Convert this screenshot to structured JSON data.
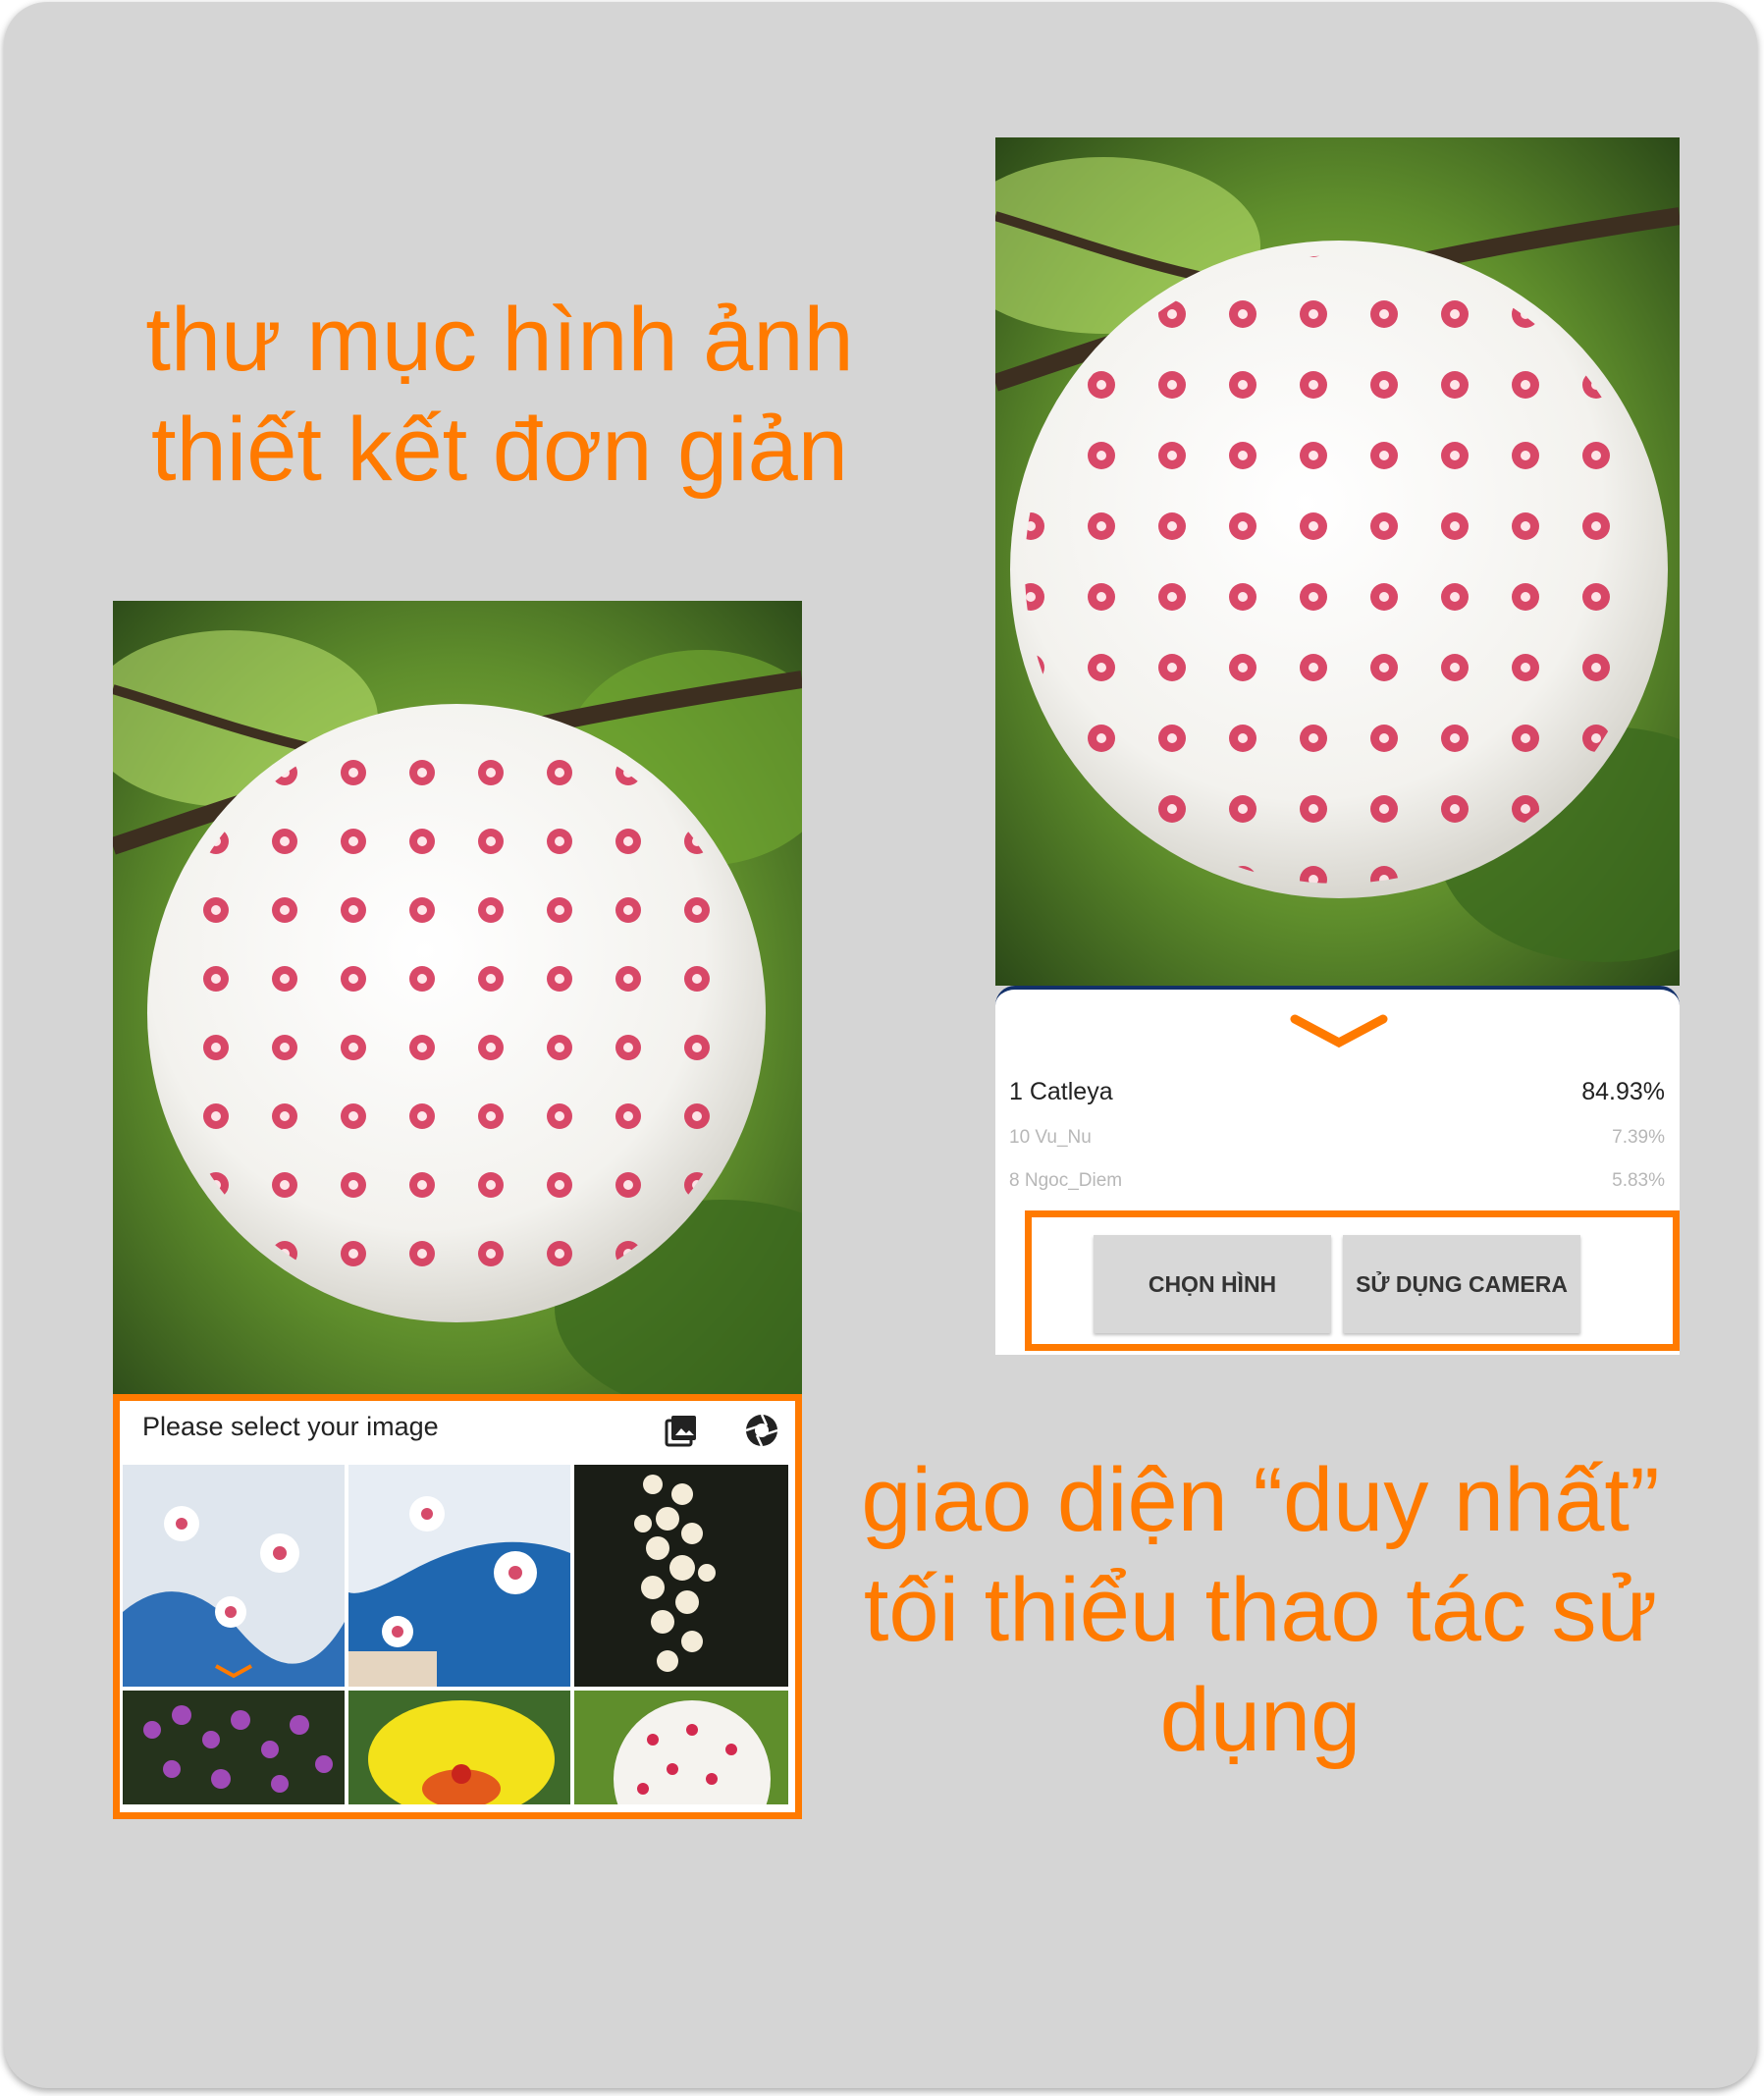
{
  "captions": {
    "top_line1": "thư mục hình ảnh",
    "top_line2": "thiết kết đơn giản",
    "bottom_line1": "giao diện “duy nhất”",
    "bottom_line2": "tối thiểu thao tác sử",
    "bottom_line3": "dụng"
  },
  "left_screen": {
    "sheet_title": "Please select your image",
    "icons": [
      "gallery-icon",
      "camera-shutter-icon"
    ]
  },
  "right_screen": {
    "results": [
      {
        "label": "1 Catleya",
        "value": "84.93%"
      },
      {
        "label": "10 Vu_Nu",
        "value": "7.39%"
      },
      {
        "label": "8 Ngoc_Diem",
        "value": "5.83%"
      }
    ],
    "buttons": {
      "choose": "CHỌN HÌNH",
      "camera": "SỬ DỤNG CAMERA"
    }
  },
  "colors": {
    "accent": "#ff7a00",
    "panel_bg": "#d5d5d5",
    "button_bg": "#d8d8d8",
    "header_line": "#12306a"
  }
}
